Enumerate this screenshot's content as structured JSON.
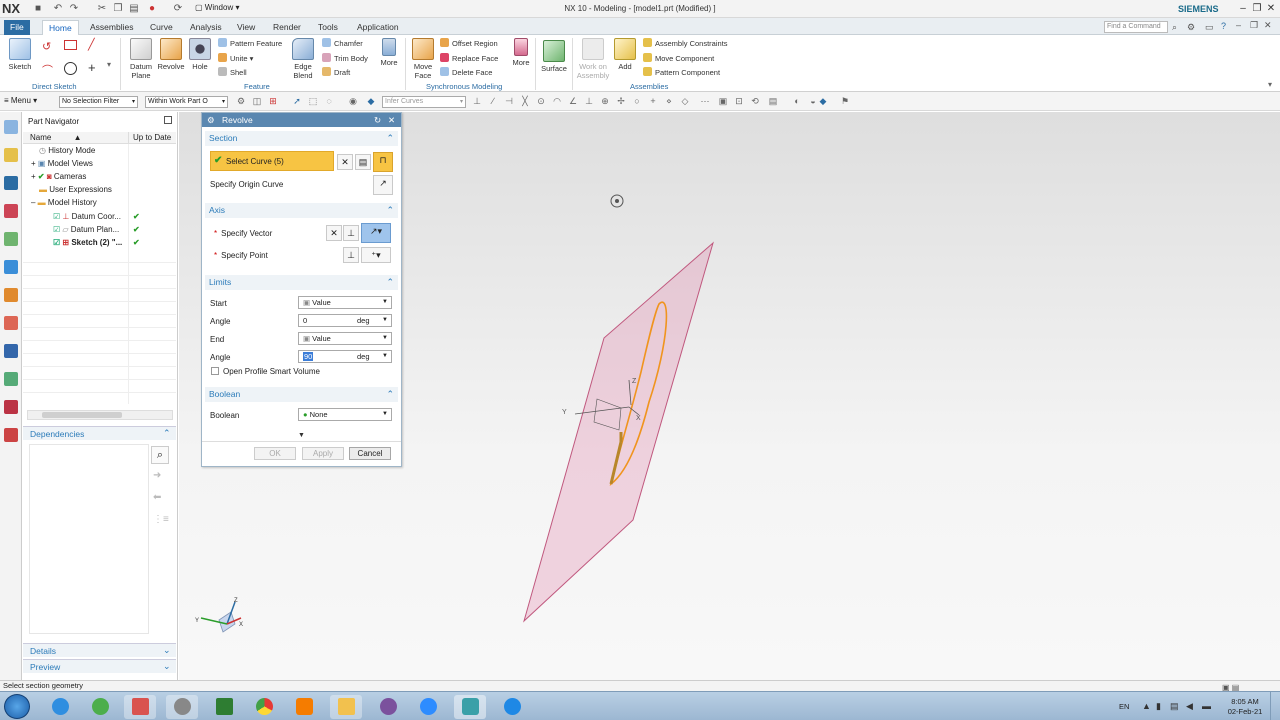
{
  "titlebar": {
    "logo": "NX",
    "window_menu": "Window",
    "title": "NX 10 - Modeling - [model1.prt (Modified) ]",
    "brand": "SIEMENS"
  },
  "tabs": [
    "File",
    "Home",
    "Assemblies",
    "Curve",
    "Analysis",
    "View",
    "Render",
    "Tools",
    "Application"
  ],
  "find_command_placeholder": "Find a Command",
  "ribbon": {
    "sketch": "Sketch",
    "group_direct_sketch": "Direct Sketch",
    "datum_plane": "Datum Plane",
    "revolve": "Revolve",
    "hole": "Hole",
    "pattern_feature": "Pattern Feature",
    "unite": "Unite",
    "shell": "Shell",
    "edge_blend": "Edge Blend",
    "chamfer": "Chamfer",
    "trim_body": "Trim Body",
    "draft": "Draft",
    "more": "More",
    "group_feature": "Feature",
    "move_face": "Move Face",
    "offset_region": "Offset Region",
    "replace_face": "Replace Face",
    "delete_face": "Delete Face",
    "more2": "More",
    "group_sync": "Synchronous Modeling",
    "surface": "Surface",
    "work_on_assembly": "Work on Assembly",
    "add": "Add",
    "assembly_constraints": "Assembly Constraints",
    "move_component": "Move Component",
    "pattern_component": "Pattern Component",
    "group_assemblies": "Assemblies"
  },
  "selbar": {
    "menu": "Menu",
    "filter": "No Selection Filter",
    "scope": "Within Work Part O",
    "infer": "Infer Curves"
  },
  "navigator": {
    "title": "Part Navigator",
    "col_name": "Name",
    "col_status": "Up to Date",
    "rows": [
      "History Mode",
      "Model Views",
      "Cameras",
      "User Expressions",
      "Model History",
      "Datum Coor...",
      "Datum Plan...",
      "Sketch (2) \"..."
    ],
    "dependencies": "Dependencies",
    "details": "Details",
    "preview": "Preview"
  },
  "dialog": {
    "title": "Revolve",
    "section": "Section",
    "select_curve": "Select Curve (5)",
    "specify_origin_curve": "Specify Origin Curve",
    "axis": "Axis",
    "specify_vector": "Specify Vector",
    "specify_point": "Specify Point",
    "limits": "Limits",
    "start": "Start",
    "start_value": "Value",
    "angle": "Angle",
    "start_angle": "0",
    "unit": "deg",
    "end": "End",
    "end_value": "Value",
    "end_angle": "90",
    "open_profile": "Open Profile Smart Volume",
    "boolean_section": "Boolean",
    "boolean_label": "Boolean",
    "boolean_value": "None",
    "ok": "OK",
    "apply": "Apply",
    "cancel": "Cancel"
  },
  "status": "Select section geometry",
  "tray": {
    "lang": "EN",
    "time": "8:05 AM",
    "date": "02-Feb-21"
  },
  "taskbar_apps": [
    "start",
    "internet-explorer",
    "app-green",
    "grid-app",
    "tool-app",
    "excel",
    "chrome",
    "media-player",
    "file-explorer",
    "viber",
    "zoom",
    "nx",
    "zalo"
  ],
  "axis_labels": {
    "x": "X",
    "y": "Y",
    "z": "Z"
  }
}
